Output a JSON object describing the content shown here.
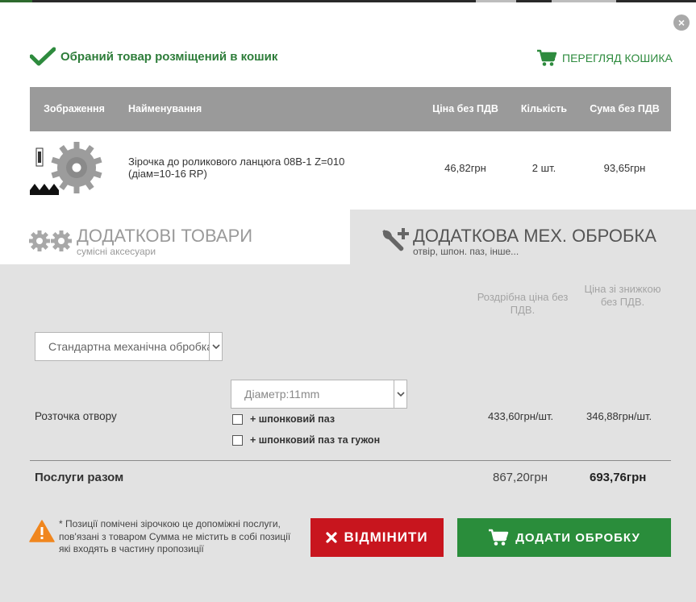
{
  "modal": {
    "close_label": "×",
    "added_message": "Обраний товар розміщений в кошик",
    "view_cart_label": "ПЕРЕГЛЯД КОШИКА"
  },
  "cart_table": {
    "headers": {
      "image": "Зображення",
      "name": "Найменування",
      "price": "Ціна без ПДВ",
      "qty": "Кількість",
      "sum": "Сума без ПДВ"
    },
    "row": {
      "name": "Зірочка до роликового ланцюга 08B-1 Z=010 (діам=10-16 RP)",
      "price": "46,82грн",
      "qty": "2 шт.",
      "sum": "93,65грн"
    }
  },
  "tabs": [
    {
      "title": "ДОДАТКОВІ ТОВАРИ",
      "subtitle": "сумісні аксесуари"
    },
    {
      "title": "ДОДАТКОВА МЕХ. ОБРОБКА",
      "subtitle": "отвір, шпон. паз, інше..."
    }
  ],
  "processing": {
    "col_retail": "Роздрібна ціна без ПДВ.",
    "col_discount": "Ціна зі знижкою без ПДВ.",
    "standard_select_value": "Стандартна механічна обробка",
    "row_label": "Розточка отвору",
    "diameter_select_value": "Діаметр:11mm",
    "option_1": "+ шпонковий паз",
    "option_2": "+ шпонковий паз та гужон",
    "row_price_retail": "433,60грн/шт.",
    "row_price_discount": "346,88грн/шт.",
    "total_label": "Послуги разом",
    "total_retail": "867,20грн",
    "total_discount": "693,76грн"
  },
  "footer": {
    "note": "* Позиції помічені зірочкою це допоміжні послуги, пов'язані з товаром Сумма не містить в собі позиції які входять в частину пропозиції",
    "cancel_label": "ВІДМІНИТИ",
    "add_label": "ДОДАТИ ОБРОБКУ"
  },
  "colors": {
    "green": "#2a8d3b",
    "red": "#c8151e",
    "header_gray": "#9a9a9a",
    "warning_orange": "#f0861e"
  }
}
